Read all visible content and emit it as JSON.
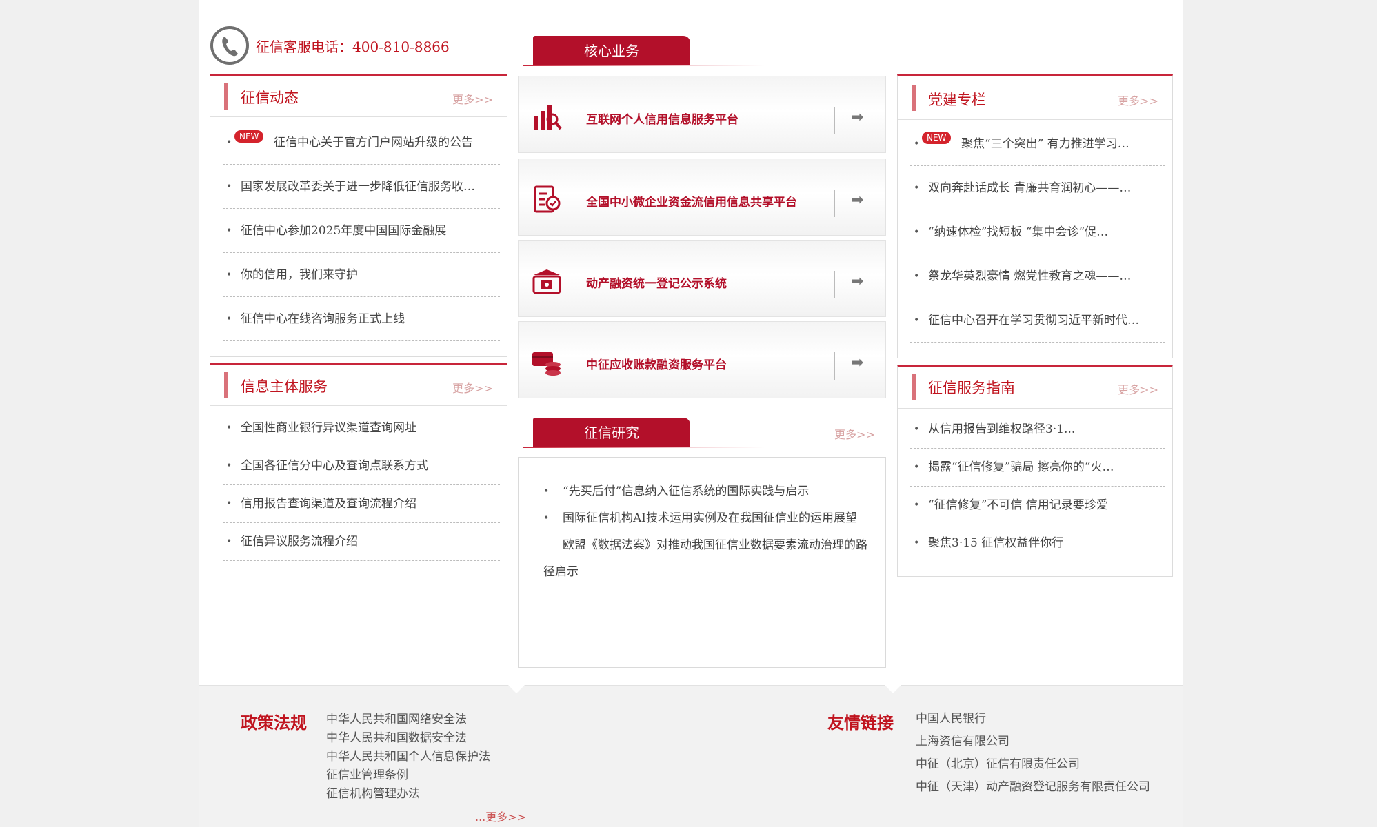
{
  "hotline": {
    "text": "征信客服电话：400-810-8866"
  },
  "news": {
    "title": "征信动态",
    "more": "更多>>",
    "items": [
      {
        "text": "征信中心关于官方门户网站升级的公告",
        "badge": "NEW"
      },
      {
        "text": "国家发展改革委关于进一步降低征信服务收…"
      },
      {
        "text": "征信中心参加2025年度中国国际金融展"
      },
      {
        "text": "你的信用，我们来守护"
      },
      {
        "text": "征信中心在线咨询服务正式上线"
      }
    ]
  },
  "subject_service": {
    "title": "信息主体服务",
    "more": "更多>>",
    "items": [
      {
        "text": "全国性商业银行异议渠道查询网址"
      },
      {
        "text": "全国各征信分中心及查询点联系方式"
      },
      {
        "text": "信用报告查询渠道及查询流程介绍"
      },
      {
        "text": "征信异议服务流程介绍"
      }
    ]
  },
  "core": {
    "tab": "核心业务",
    "items": [
      {
        "label": "互联网个人信用信息服务平台",
        "icon": "chart-icon"
      },
      {
        "label": "全国中小微企业资金流信用信息共享平台",
        "icon": "document-icon"
      },
      {
        "label": "动产融资统一登记公示系统",
        "icon": "registry-icon"
      },
      {
        "label": "中征应收账款融资服务平台",
        "icon": "coins-card-icon"
      }
    ],
    "arrow": "➡"
  },
  "research": {
    "tab": "征信研究",
    "more": "更多>>",
    "items": [
      "“先买后付”信息纳入征信系统的国际实践与启示",
      "国际征信机构AI技术运用实例及在我国征信业的运用展望",
      "欧盟《数据法案》对推动我国征信业数据要素流动治理的路径启示"
    ]
  },
  "party": {
    "title": "党建专栏",
    "more": "更多>>",
    "items": [
      {
        "text": "聚焦“三个突出” 有力推进学习…",
        "badge": "NEW"
      },
      {
        "text": "双向奔赴话成长 青廉共育润初心——…"
      },
      {
        "text": "“纳速体检”找短板 “集中会诊”促…"
      },
      {
        "text": "祭龙华英烈豪情 燃党性教育之魂——…"
      },
      {
        "text": "征信中心召开在学习贯彻习近平新时代…"
      }
    ]
  },
  "guide": {
    "title": "征信服务指南",
    "more": "更多>>",
    "items": [
      {
        "text": "从信用报告到维权路径3·1..."
      },
      {
        "text": "揭露“征信修复”骗局 擦亮你的“火…"
      },
      {
        "text": "“征信修复”不可信 信用记录要珍爱"
      },
      {
        "text": "聚焦3·15 征信权益伴你行"
      }
    ]
  },
  "policy": {
    "title": "政策法规",
    "items": [
      "中华人民共和国网络安全法",
      "中华人民共和国数据安全法",
      "中华人民共和国个人信息保护法",
      "征信业管理条例",
      "征信机构管理办法"
    ],
    "more": "...更多>>"
  },
  "links": {
    "title": "友情链接",
    "items": [
      "中国人民银行",
      "上海资信有限公司",
      "中征（北京）征信有限责任公司",
      "中征（天津）动产融资登记服务有限责任公司"
    ]
  },
  "colors": {
    "brand_red": "#c0141f",
    "tab_red": "#b3102a",
    "box_border": "#c8253a"
  }
}
